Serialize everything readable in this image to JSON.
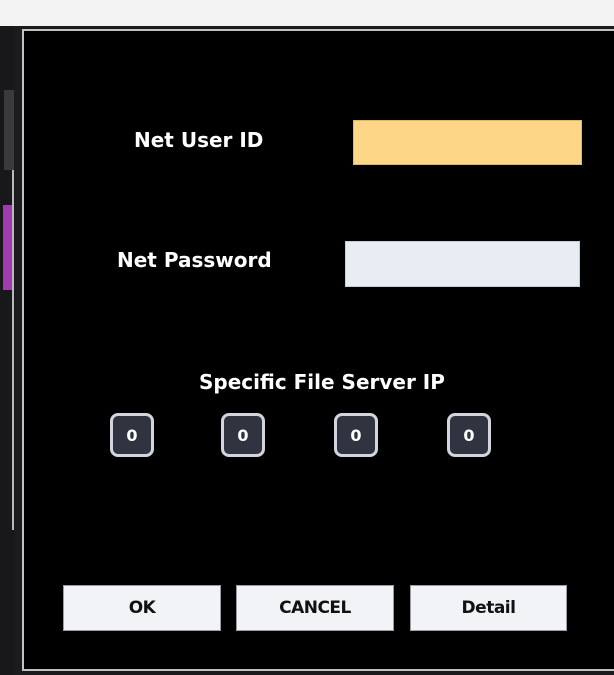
{
  "dialog": {
    "user_id_label": "Net User ID",
    "user_id_value": "",
    "password_label": "Net Password",
    "password_value": "",
    "server_ip_label": "Specific File Server IP",
    "server_ip_octets": [
      "0",
      "0",
      "0",
      "0"
    ]
  },
  "buttons": {
    "ok_label": "OK",
    "cancel_label": "CANCEL",
    "detail_label": "Detail"
  },
  "colors": {
    "dialog_background": "#000000",
    "focused_field": "#fdd787",
    "field": "#e8edf3",
    "ip_box": "#2f3440",
    "button": "#f1f3f6"
  }
}
